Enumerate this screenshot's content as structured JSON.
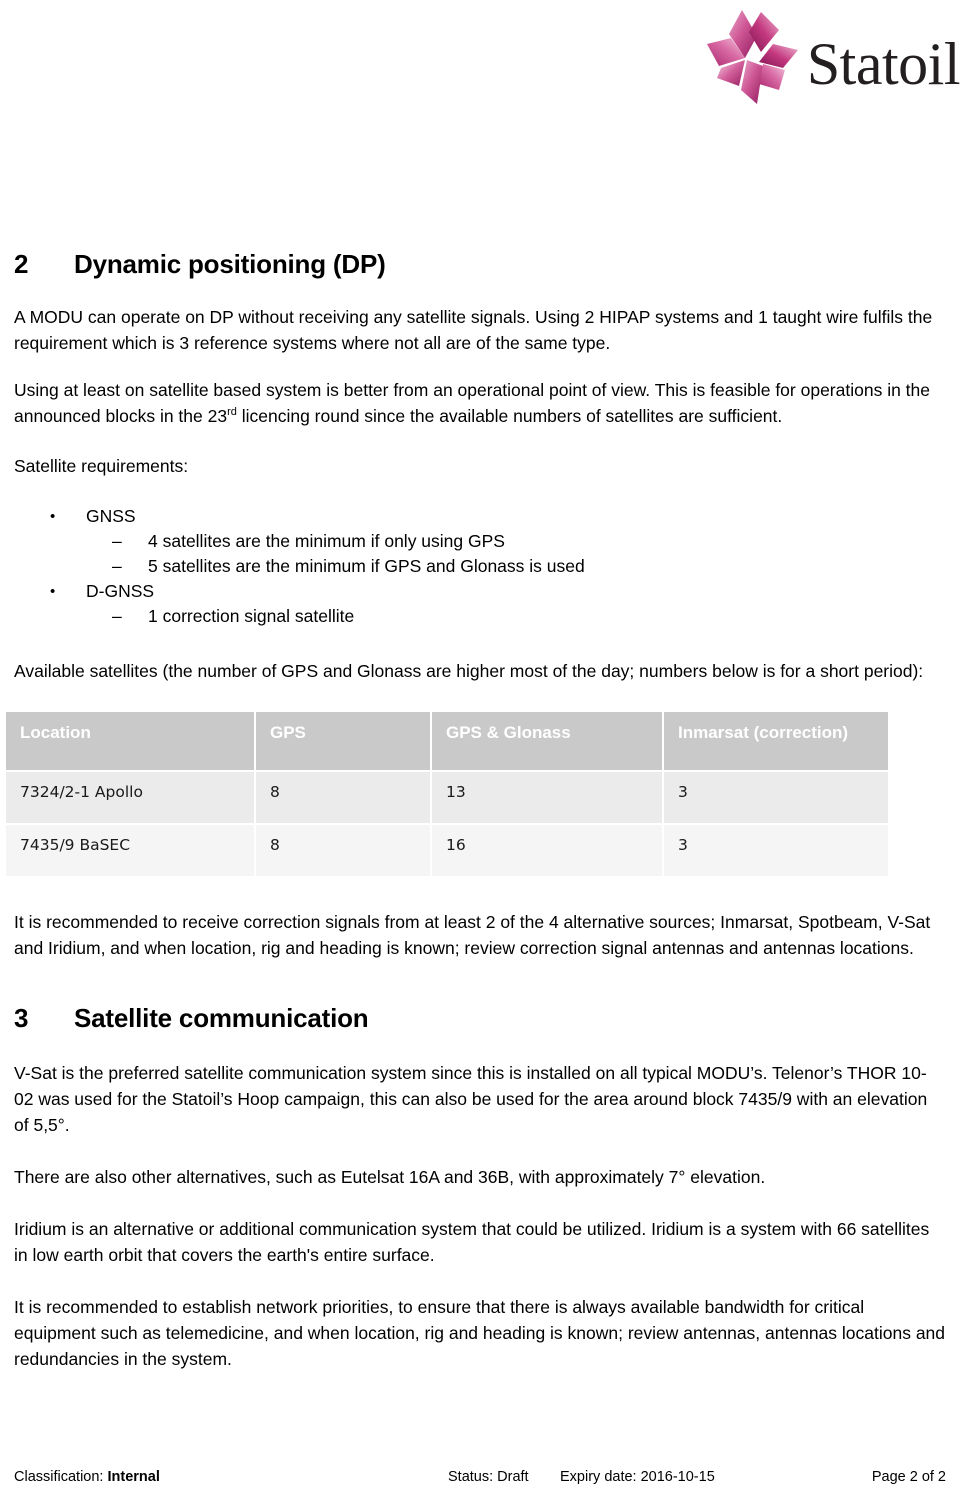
{
  "brand": {
    "name": "Statoil",
    "logo_icon": "statoil-star-logo",
    "colors": {
      "primary_pink": "#c4387f",
      "light_pink": "#e48ab8",
      "deep_magenta": "#9c1d63",
      "wordmark": "#231f20"
    }
  },
  "sections": [
    {
      "number": "2",
      "title": "Dynamic positioning (DP)"
    },
    {
      "number": "3",
      "title": "Satellite communication"
    }
  ],
  "paragraphs": {
    "p1": "A MODU can operate on DP without receiving any satellite signals. Using 2 HIPAP systems and 1 taught wire fulfils the requirement which is 3 reference systems where not all are of the same type.",
    "p2_before_sup": "Using at least on satellite based system is better from an operational point of view. This is feasible for operations in the announced blocks in the 23",
    "p2_sup": "rd",
    "p2_after_sup": " licencing round since the available numbers of satellites are sufficient.",
    "requirements_label": "Satellite requirements:",
    "available_label": "Available satellites (the number of GPS and Glonass are higher most of the day; numbers below is for a short period):",
    "p3": "It is recommended to receive correction signals from at least 2 of the 4 alternative sources; Inmarsat, Spotbeam, V-Sat and Iridium, and when location, rig and heading is known; review correction signal antennas and antennas locations.",
    "p4": "V-Sat is the preferred satellite communication system since this is installed on all typical MODU’s. Telenor’s THOR 10-02 was used for the Statoil’s Hoop campaign, this can also be used for the area around block 7435/9 with an elevation of 5,5°.",
    "p5": "There are also other alternatives, such as Eutelsat 16A and 36B, with approximately 7° elevation.",
    "p6": "Iridium is an alternative or additional communication system that could be utilized. Iridium is a system with 66 satellites in low earth orbit that covers the earth's entire surface.",
    "p7": "It is recommended to establish network priorities, to ensure that there is always available bandwidth for critical equipment such as telemedicine, and when location, rig and heading is known; review antennas, antennas locations and redundancies in the system."
  },
  "bullets": [
    {
      "marker": "•",
      "label": "GNSS",
      "children": [
        {
          "marker": "–",
          "label": "4 satellites are the minimum if only using GPS"
        },
        {
          "marker": "–",
          "label": "5 satellites are the minimum if GPS and Glonass is used"
        }
      ]
    },
    {
      "marker": "•",
      "label": "D-GNSS",
      "children": [
        {
          "marker": "–",
          "label": "1 correction signal satellite"
        }
      ]
    }
  ],
  "table": {
    "header_bg": "#c9c9c9",
    "row_bg_odd": "#ebebeb",
    "row_bg_even": "#f5f5f5",
    "columns": [
      "Location",
      "GPS",
      "GPS & Glonass",
      "Inmarsat (correction)"
    ],
    "rows": [
      [
        "7324/2-1 Apollo",
        "8",
        "13",
        "3"
      ],
      [
        "7435/9 BaSEC",
        "8",
        "16",
        "3"
      ]
    ]
  },
  "footer": {
    "classification_label": "Classification:",
    "classification_value": "Internal",
    "status": "Status: Draft",
    "expiry": "Expiry date: 2016-10-15",
    "page": "Page 2 of 2"
  }
}
